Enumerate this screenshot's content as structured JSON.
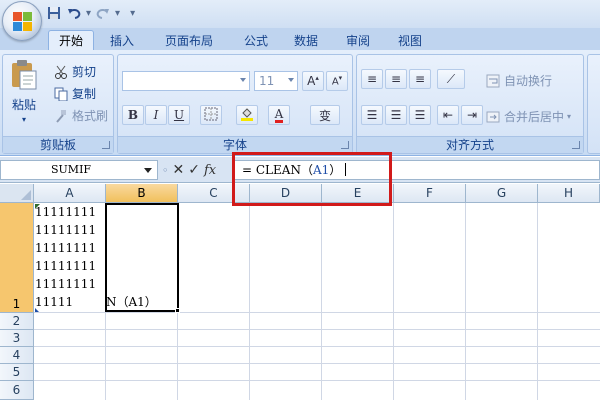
{
  "qat": {
    "separator": "▾"
  },
  "tabs": [
    "开始",
    "插入",
    "页面布局",
    "公式",
    "数据",
    "审阅",
    "视图"
  ],
  "clipboard": {
    "paste_label": "粘贴",
    "cut_label": "剪切",
    "copy_label": "复制",
    "format_painter_label": "格式刷",
    "group_label": "剪贴板"
  },
  "font": {
    "font_name": "",
    "font_size": "11",
    "bold": "B",
    "italic": "I",
    "underline": "U",
    "phonetic": "变",
    "group_label": "字体"
  },
  "alignment": {
    "wrap_text_label": "自动换行",
    "merge_label": "合并后居中",
    "group_label": "对齐方式"
  },
  "formula_bar": {
    "name_box": "SUMIF",
    "fx_label": "fx",
    "formula_prefix": "= CLEAN（",
    "formula_ref": "A1",
    "formula_suffix": "）"
  },
  "grid": {
    "columns": [
      "A",
      "B",
      "C",
      "D",
      "E",
      "F",
      "G",
      "H"
    ],
    "rows": [
      "1",
      "2",
      "3",
      "4",
      "5",
      "6"
    ],
    "a1_lines": [
      "11111111",
      "11111111",
      "11111111",
      "11111111",
      "11111111",
      "11111"
    ],
    "b1_text": "N（A1）"
  },
  "colors": {
    "highlight": "#d11a1a",
    "selected_header": "#f6c66e",
    "ribbon": "#d5e3f6"
  }
}
